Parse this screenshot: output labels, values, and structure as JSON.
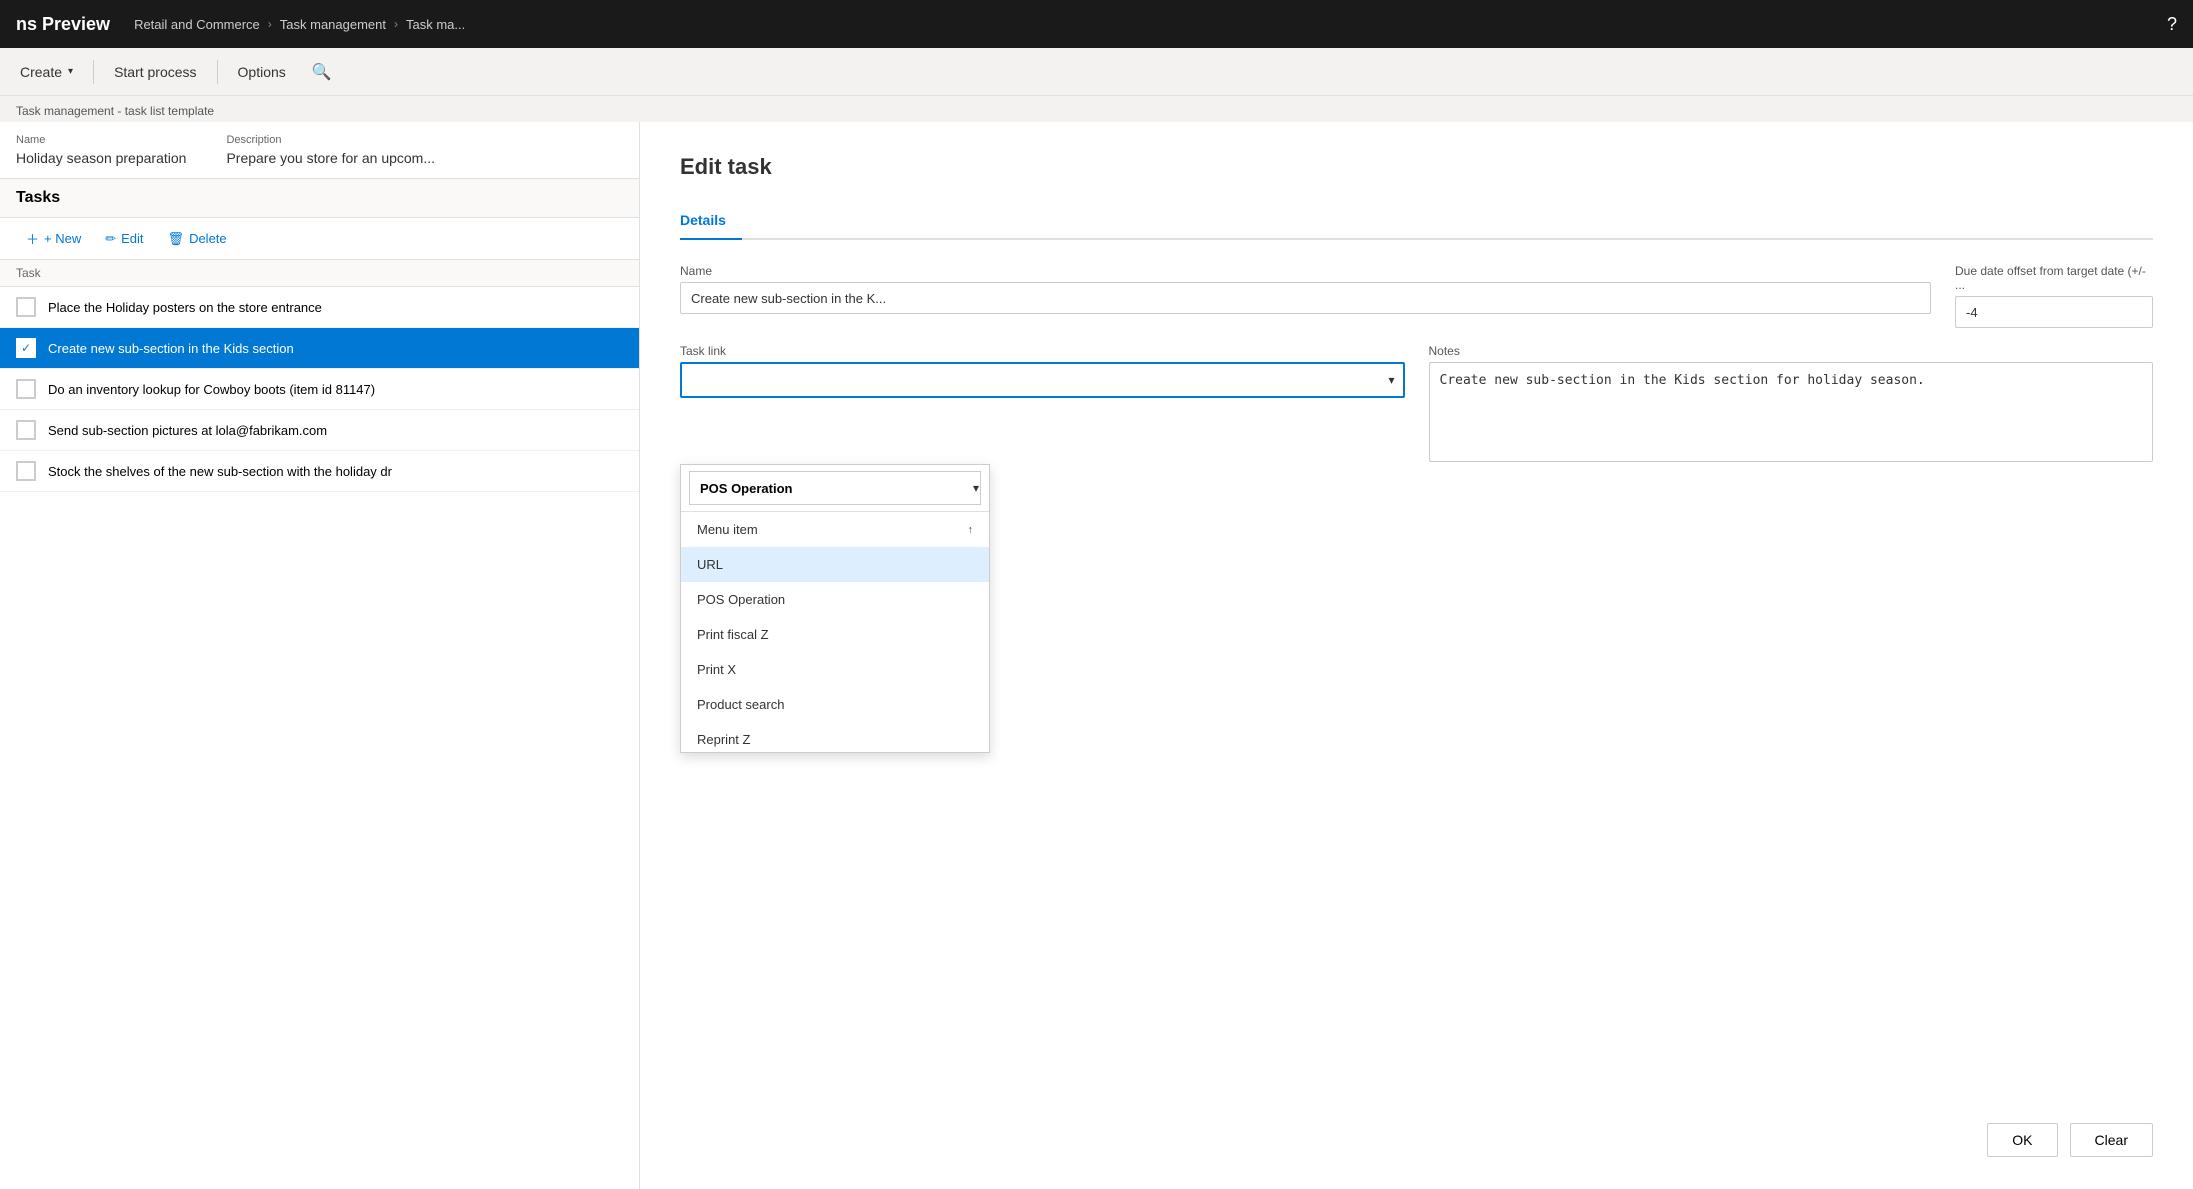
{
  "app": {
    "title": "ns Preview",
    "help_icon": "?"
  },
  "breadcrumb": {
    "items": [
      "Retail and Commerce",
      "Task management",
      "Task ma..."
    ]
  },
  "toolbar": {
    "create_btn": "Create",
    "start_process_btn": "Start process",
    "options_btn": "Options",
    "search_icon": "🔍"
  },
  "page": {
    "subtitle": "Task management - task list template"
  },
  "record": {
    "name_label": "Name",
    "name_value": "Holiday season preparation",
    "description_label": "Description",
    "description_value": "Prepare you store for an upcom..."
  },
  "tasks_section": {
    "title": "Tasks",
    "new_btn": "+ New",
    "edit_btn": "Edit",
    "delete_btn": "Delete",
    "col_task": "Task"
  },
  "task_list": [
    {
      "id": 1,
      "text": "Place the Holiday posters on the store entrance",
      "checked": false,
      "selected": false
    },
    {
      "id": 2,
      "text": "Create new sub-section in the Kids section",
      "checked": true,
      "selected": true
    },
    {
      "id": 3,
      "text": "Do an inventory lookup for Cowboy boots (item id 81147)",
      "checked": false,
      "selected": false
    },
    {
      "id": 4,
      "text": "Send sub-section pictures at lola@fabrikam.com",
      "checked": false,
      "selected": false
    },
    {
      "id": 5,
      "text": "Stock the shelves of the new sub-section with the holiday dr",
      "checked": false,
      "selected": false
    }
  ],
  "edit_task": {
    "title": "Edit task",
    "tab_details": "Details",
    "name_label": "Name",
    "name_value": "Create new sub-section in the K...",
    "due_date_label": "Due date offset from target date (+/- ...",
    "due_date_value": "-4",
    "task_link_label": "Task link",
    "task_link_value": "",
    "task_link_placeholder": "",
    "notes_label": "Notes",
    "notes_value": "Create new sub-section in the Kids section for holiday season.",
    "ok_btn": "OK",
    "clear_btn": "Clear"
  },
  "dropdown": {
    "selected": "POS Operation",
    "items": [
      {
        "id": "menu_item",
        "label": "Menu item",
        "has_arrow": true
      },
      {
        "id": "url",
        "label": "URL",
        "highlighted": true
      },
      {
        "id": "pos_operation",
        "label": "POS Operation",
        "is_selected": true
      },
      {
        "id": "print_fiscal_z",
        "label": "Print fiscal Z"
      },
      {
        "id": "print_x",
        "label": "Print X"
      },
      {
        "id": "product_search",
        "label": "Product search"
      },
      {
        "id": "reprint_z",
        "label": "Reprint Z"
      }
    ]
  }
}
